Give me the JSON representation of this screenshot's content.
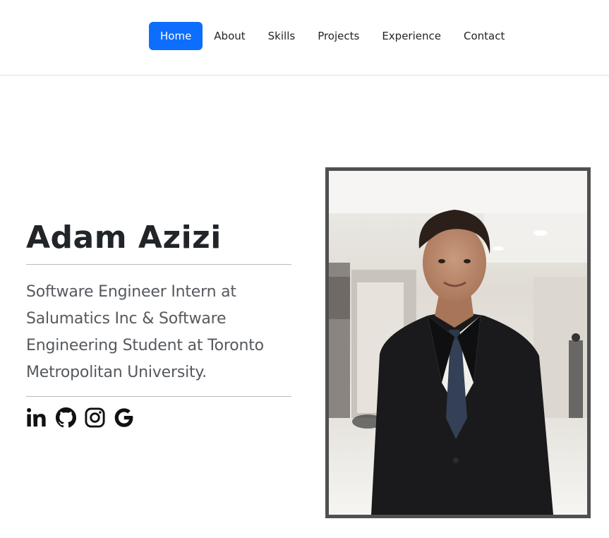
{
  "nav": {
    "items": [
      {
        "label": "Home",
        "active": true
      },
      {
        "label": "About",
        "active": false
      },
      {
        "label": "Skills",
        "active": false
      },
      {
        "label": "Projects",
        "active": false
      },
      {
        "label": "Experience",
        "active": false
      },
      {
        "label": "Contact",
        "active": false
      }
    ],
    "accent_color": "#0d6efd"
  },
  "hero": {
    "name": "Adam Azizi",
    "tagline": "Software Engineer Intern at Salumatics Inc & Software Engineering Student at Toronto Metropolitan University.",
    "socials": [
      {
        "icon": "linkedin-icon"
      },
      {
        "icon": "github-icon"
      },
      {
        "icon": "instagram-icon"
      },
      {
        "icon": "google-icon"
      }
    ],
    "photo": {
      "subject": "portrait-photo",
      "frame_color": "#505050"
    }
  }
}
